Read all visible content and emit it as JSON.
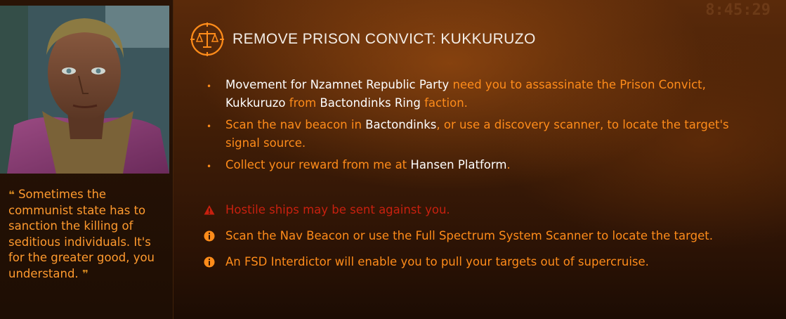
{
  "mission": {
    "title": "REMOVE PRISON CONVICT: KUKKURUZO",
    "icon": "scales-of-justice-icon"
  },
  "quote": {
    "text": "Sometimes the communist state has to sanction the killing of seditious individuals. It's for the greater good, you understand.",
    "open_mark": "❝",
    "close_mark": "❞"
  },
  "objectives": [
    {
      "p1": "Movement for Nzamnet Republic Party",
      "p2": " need you to assassinate the Prison Convict, ",
      "p3": "Kukkuruzo",
      "p4": " from ",
      "p5": "Bactondinks Ring",
      "p6": " faction."
    },
    {
      "p1": "Scan the nav beacon in ",
      "p2": "Bactondinks",
      "p3": ", or use a discovery scanner, to locate the target's signal source."
    },
    {
      "p1": "Collect your reward from me at ",
      "p2": "Hansen Platform",
      "p3": "."
    }
  ],
  "notes": [
    {
      "type": "warning",
      "icon": "warning-triangle-icon",
      "text": "Hostile ships may be sent against you."
    },
    {
      "type": "info",
      "icon": "info-circle-icon",
      "text": "Scan the Nav Beacon or use the Full Spectrum System Scanner to locate the target."
    },
    {
      "type": "info",
      "icon": "info-circle-icon",
      "text": "An FSD Interdictor will enable you to pull your targets out of supercruise."
    }
  ],
  "hud": {
    "clock": "8:45:29"
  },
  "colors": {
    "accent_orange": "#ff8c1a",
    "highlight_white": "#ffffff",
    "warning_red": "#c8200f",
    "title_white": "#f3ede6"
  }
}
